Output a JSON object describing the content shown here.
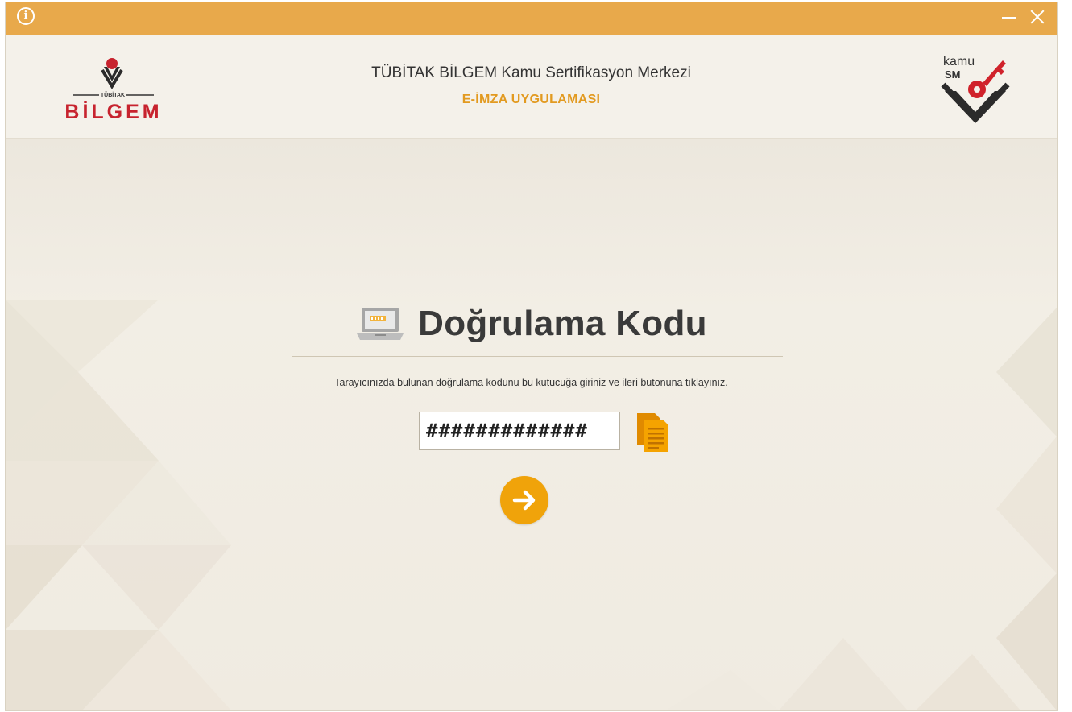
{
  "window": {
    "info_icon": "info-icon",
    "minimize_icon": "minimize-icon",
    "close_icon": "close-icon",
    "title_bar_color": "#e8a94b"
  },
  "header": {
    "left_logo": {
      "name": "bilgem-logo",
      "text_top": "TÜBİTAK",
      "text_main": "BİLGEM"
    },
    "title": "TÜBİTAK BİLGEM Kamu Sertifikasyon Merkezi",
    "subtitle": "E-İMZA UYGULAMASI",
    "right_logo": {
      "name": "kamusm-logo",
      "text_top": "kamu",
      "text_main": "SM"
    }
  },
  "main": {
    "heading_icon": "laptop-icon",
    "heading": "Doğrulama Kodu",
    "instruction": "Tarayıcınızda bulunan doğrulama kodunu bu kutucuğa giriniz ve ileri butonuna tıklayınız.",
    "code_input": {
      "value": "#############",
      "placeholder": ""
    },
    "copy_icon": "copy-paste-icon",
    "next_icon": "arrow-right-icon"
  },
  "colors": {
    "accent": "#e29a20",
    "button": "#f0a30a",
    "logo_red": "#c7232e",
    "background": "#f1ede4"
  }
}
